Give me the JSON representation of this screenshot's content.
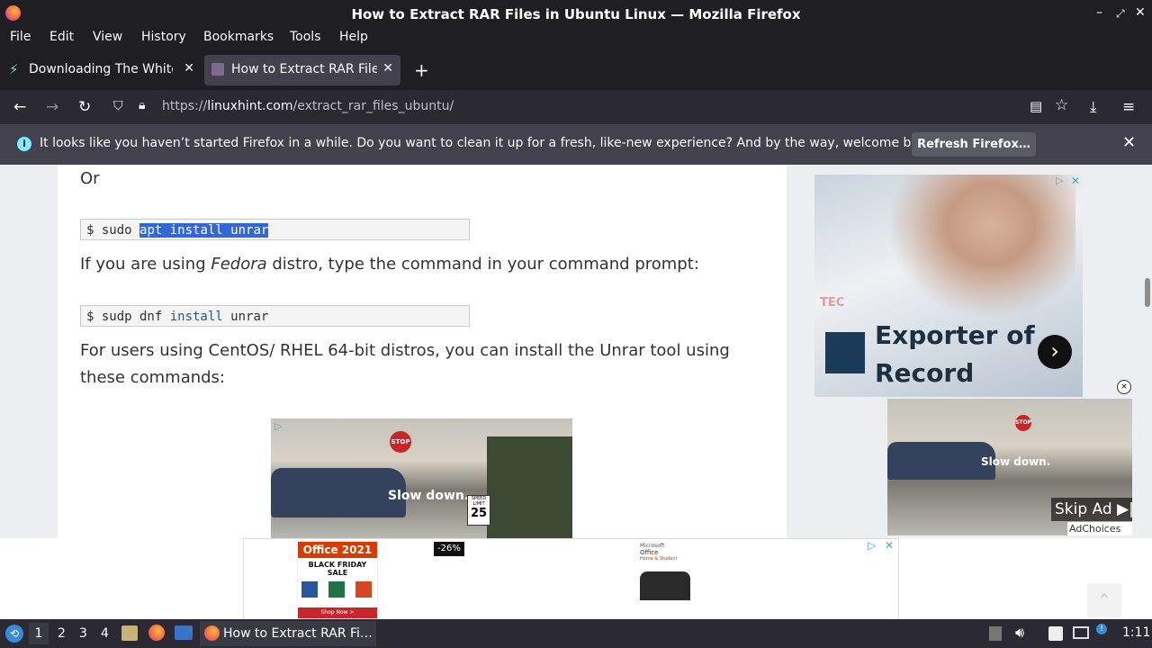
{
  "window": {
    "title": "How to Extract RAR Files in Ubuntu Linux — Mozilla Firefox"
  },
  "menu": [
    "File",
    "Edit",
    "View",
    "History",
    "Bookmarks",
    "Tools",
    "Help"
  ],
  "tabs": [
    {
      "label": "Downloading The White Lotus"
    },
    {
      "label": "How to Extract RAR Files in Ubuntu Linux"
    }
  ],
  "address": {
    "scheme": "https://",
    "domain": "linuxhint.com",
    "path": "/extract_rar_files_ubuntu/"
  },
  "notification": {
    "message": "It looks like you haven’t started Firefox in a while. Do you want to clean it up for a fresh, like-new experience? And by the way, welcome back!",
    "button": "Refresh Firefox…"
  },
  "article": {
    "or": "Or",
    "cmd1": {
      "prompt": "$ sudo ",
      "selected": "apt install unrar"
    },
    "fedora": {
      "before": "If you are using ",
      "italic": "Fedora",
      "after": " distro, type the command in your command prompt:"
    },
    "cmd2": {
      "prompt": "$ sudp dnf ",
      "kw": "install",
      "rest": " unrar"
    },
    "centos_line1": "For users using CentOS/ RHEL 64-bit distros, you can install the Unrar tool using",
    "centos_line2": "these commands:"
  },
  "ads": {
    "video_caption": "Slow down.",
    "speed_sign_top": "SPEED LIMIT",
    "speed_sign_num": "25",
    "stop": "STOP",
    "side_title_1": "Exporter of",
    "side_title_2": "Record",
    "side_logo": "TEC",
    "skip": "Skip Ad",
    "adchoices": "AdChoices",
    "bottom_office": "Office 2021",
    "bottom_sale": "BLACK FRIDAY SALE",
    "bottom_discount": "-26%",
    "bottom_shop": "Shop Now >",
    "bottom_ms": "Microsoft",
    "bottom_office_small": "Office",
    "bottom_product": "Home & Student"
  },
  "taskbar": {
    "workspaces": [
      "1",
      "2",
      "3",
      "4"
    ],
    "active_window": "How to Extract RAR Fi…",
    "clock": "1:11"
  },
  "colors": {
    "chrome": "#1f1e23",
    "toolbar": "#2b2a33",
    "notification": "#42414d",
    "selection": "#3367d6"
  }
}
